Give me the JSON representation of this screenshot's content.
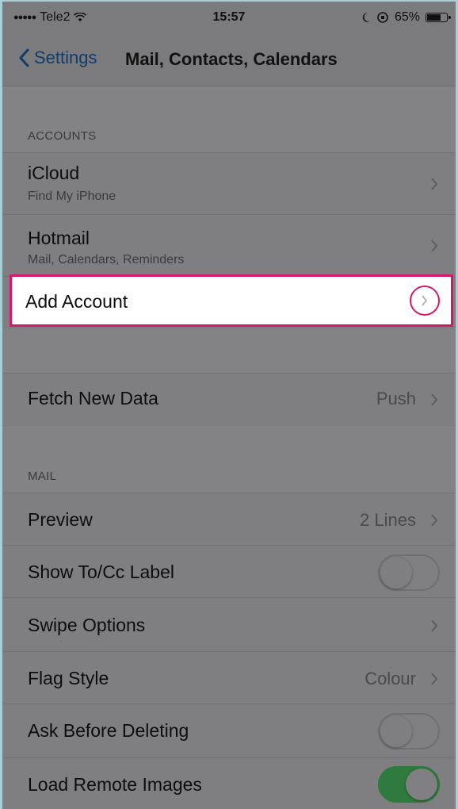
{
  "status_bar": {
    "carrier": "Tele2",
    "time": "15:57",
    "battery": "65%"
  },
  "nav": {
    "back_label": "Settings",
    "title": "Mail, Contacts, Calendars"
  },
  "accounts": {
    "header": "ACCOUNTS",
    "items": [
      {
        "label": "iCloud",
        "subtitle": "Find My iPhone"
      },
      {
        "label": "Hotmail",
        "subtitle": "Mail, Calendars, Reminders"
      }
    ],
    "add_account": "Add Account"
  },
  "fetch": {
    "label": "Fetch New Data",
    "value": "Push"
  },
  "mail": {
    "header": "MAIL",
    "preview": {
      "label": "Preview",
      "value": "2 Lines"
    },
    "show_tocc": {
      "label": "Show To/Cc Label",
      "on": false
    },
    "swipe": {
      "label": "Swipe Options"
    },
    "flag": {
      "label": "Flag Style",
      "value": "Colour"
    },
    "ask_delete": {
      "label": "Ask Before Deleting",
      "on": false
    },
    "remote_images": {
      "label": "Load Remote Images",
      "on": true
    }
  },
  "colors": {
    "highlight": "#d3196b",
    "toggle_on": "#2f7a3e",
    "link": "#123c6b"
  }
}
